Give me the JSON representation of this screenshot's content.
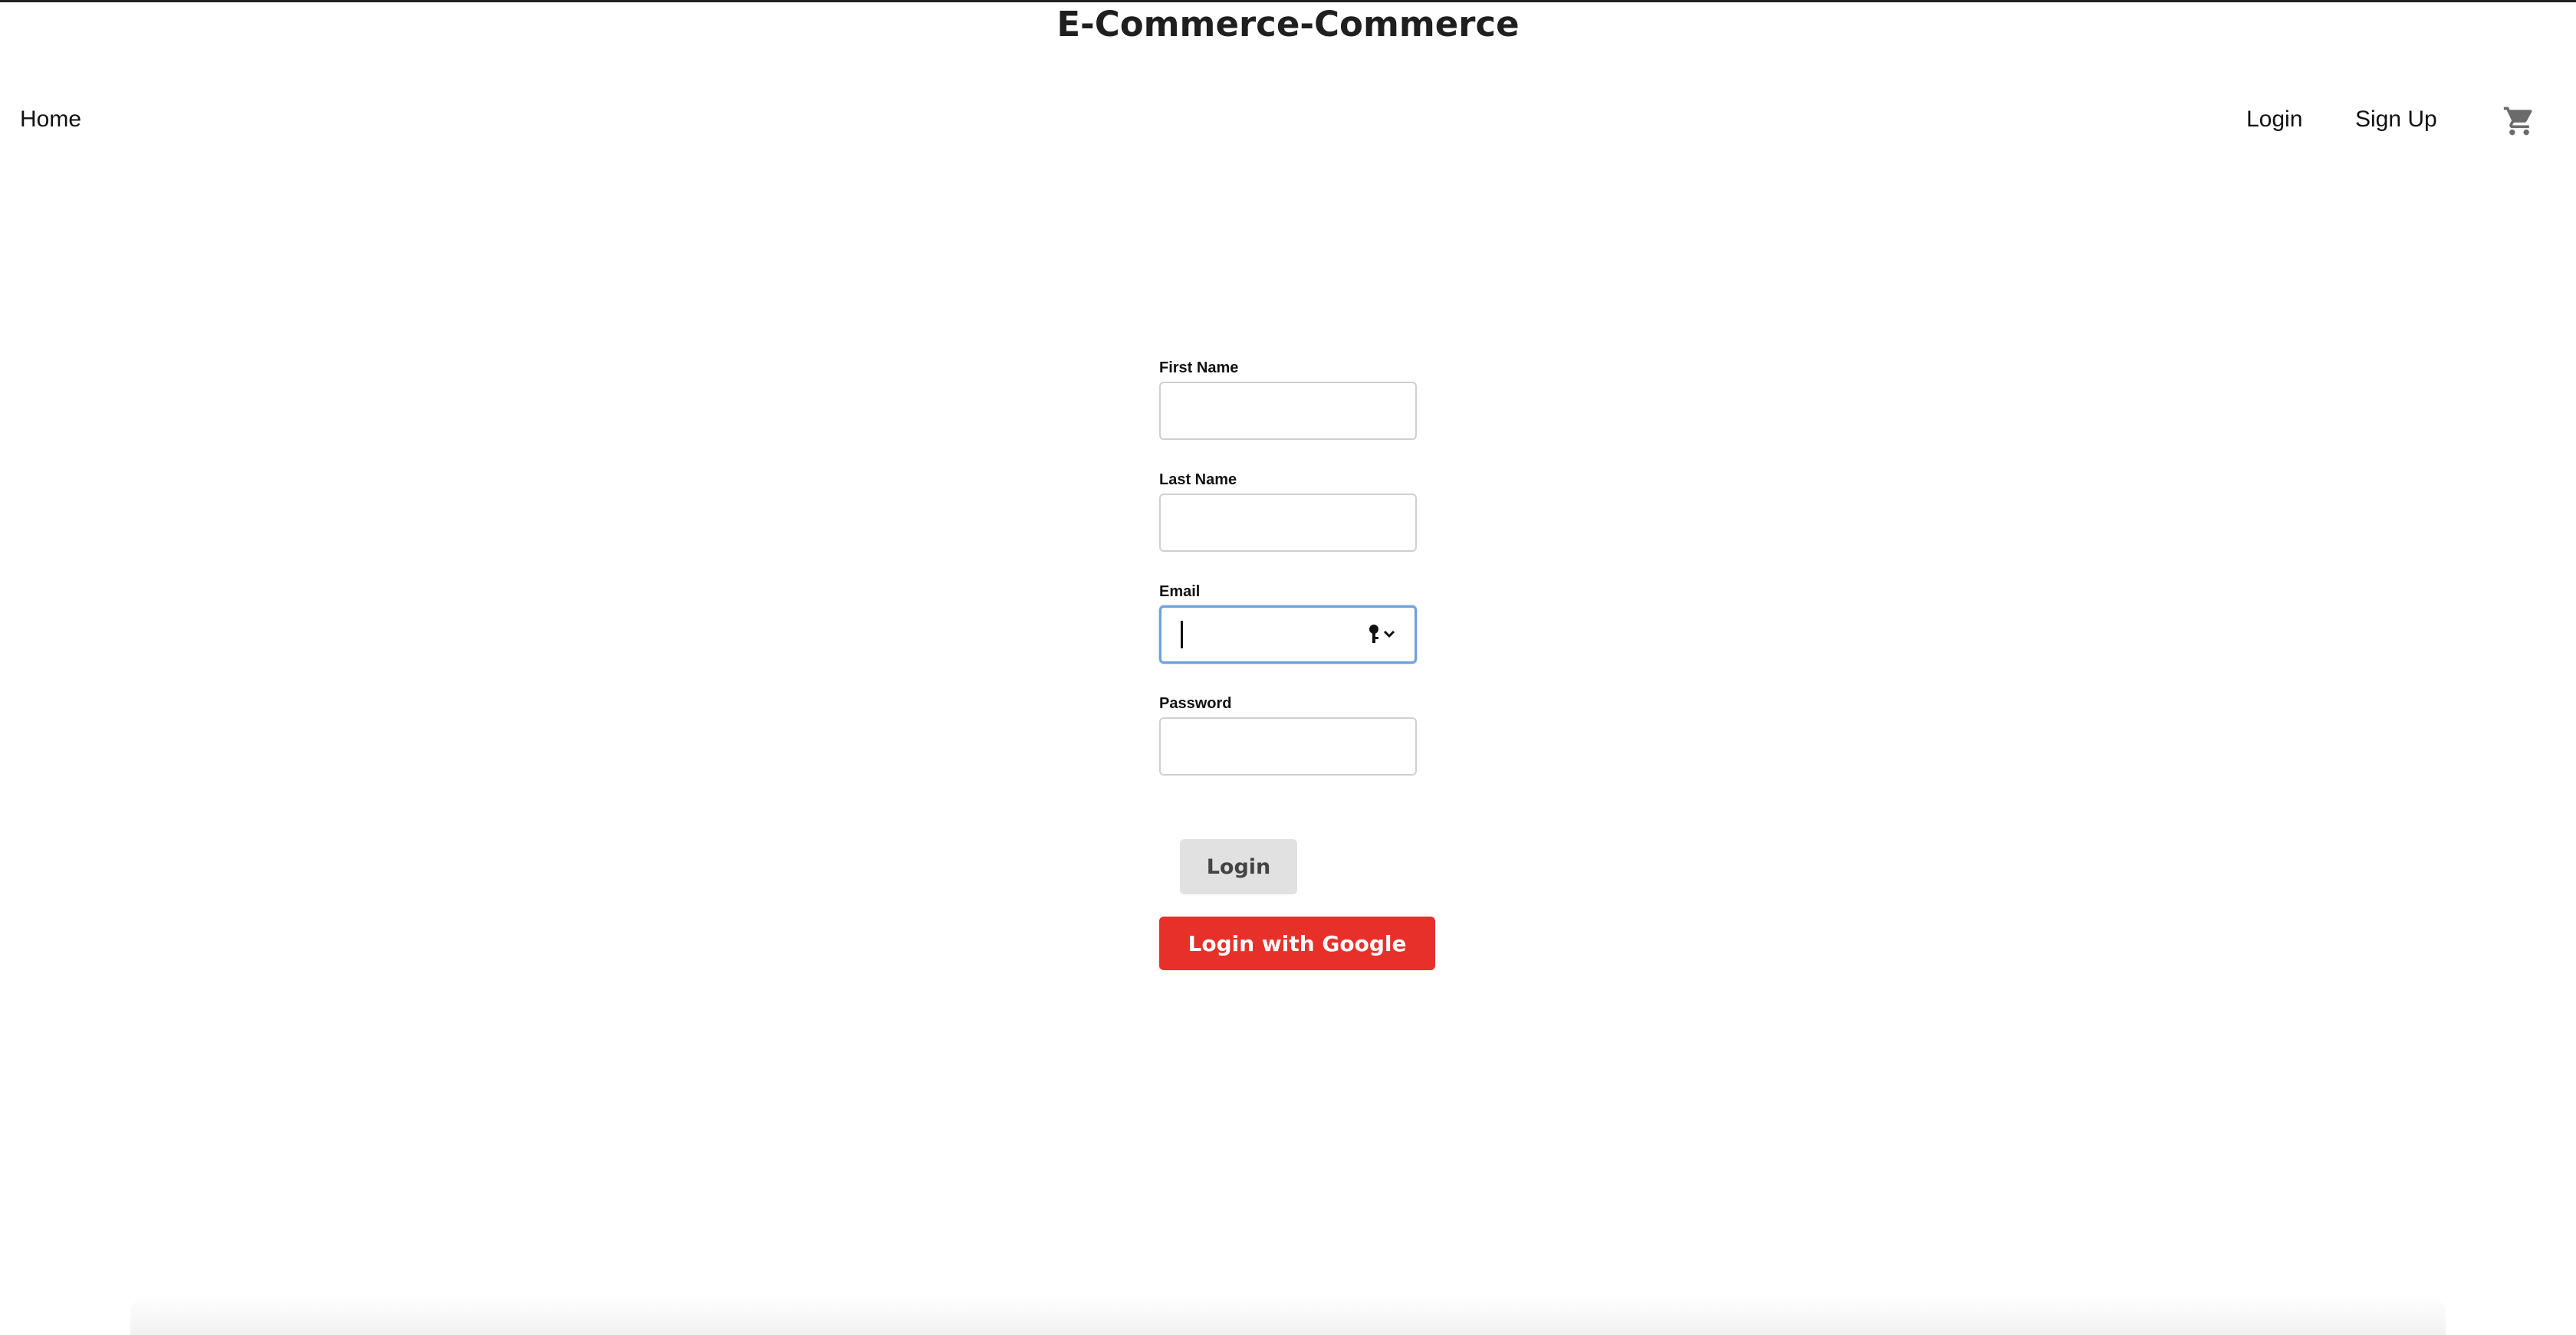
{
  "header": {
    "title": "E-Commerce-Commerce"
  },
  "nav": {
    "home": "Home",
    "login": "Login",
    "signup": "Sign Up",
    "cart_icon": "shopping-cart-icon"
  },
  "form": {
    "first_name": {
      "label": "First Name",
      "value": ""
    },
    "last_name": {
      "label": "Last Name",
      "value": ""
    },
    "email": {
      "label": "Email",
      "value": "",
      "focused": true,
      "autofill_icon": "key-icon"
    },
    "password": {
      "label": "Password",
      "value": ""
    },
    "login_button": "Login",
    "google_button": "Login with Google"
  },
  "colors": {
    "google_button": "#e8302a",
    "login_button": "#e1e1e1",
    "focus_ring": "#6fa2d6"
  }
}
